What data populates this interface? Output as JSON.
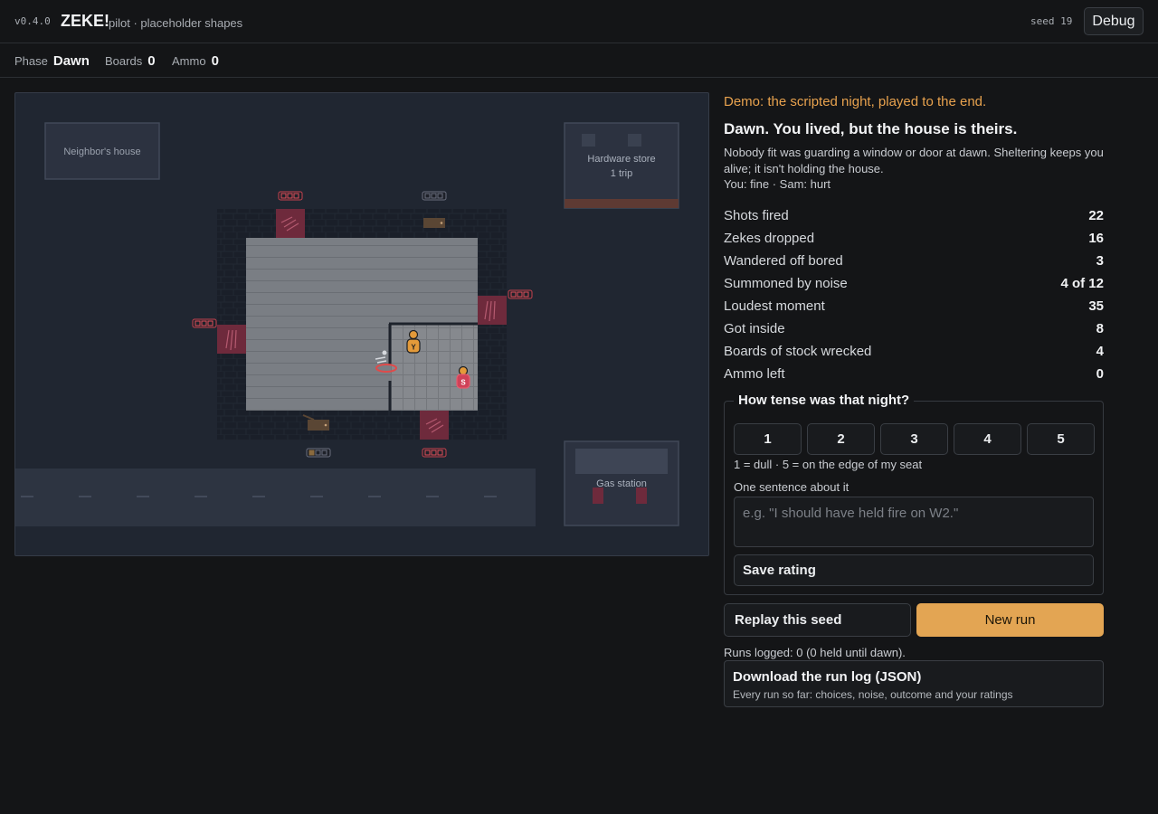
{
  "header": {
    "version": "v0.4.0",
    "brand": "ZEKE!",
    "tagline": "pilot · placeholder shapes",
    "seed": "seed 19",
    "debug_label": "Debug"
  },
  "status": {
    "phase_label": "Phase",
    "phase_value": "Dawn",
    "boards_label": "Boards",
    "boards_value": "0",
    "ammo_label": "Ammo",
    "ammo_value": "0"
  },
  "board": {
    "neighbor_label": "Neighbor's house",
    "hardware_label": "Hardware store",
    "hardware_trips": "1 trip",
    "gas_label": "Gas station",
    "you_token": "Y",
    "sam_token": "S",
    "colors": {
      "ground": "#202631",
      "lot": "#2d3441",
      "yard": "#1a1f29",
      "floor": "#787c82",
      "window_damaged": "#6e2a3c",
      "you": "#e39a3a",
      "sam": "#cf4158",
      "noise_ring": "#e04a4a"
    }
  },
  "result": {
    "demo_note": "Demo: the scripted night, played to the end.",
    "headline": "Dawn. You lived, but the house is theirs.",
    "body": "Nobody fit was guarding a window or door at dawn. Sheltering keeps you alive; it isn't holding the house.",
    "condition": "You: fine · Sam: hurt"
  },
  "stats": [
    {
      "label": "Shots fired",
      "value": "22"
    },
    {
      "label": "Zekes dropped",
      "value": "16"
    },
    {
      "label": "Wandered off bored",
      "value": "3"
    },
    {
      "label": "Summoned by noise",
      "value": "4 of 12"
    },
    {
      "label": "Loudest moment",
      "value": "35"
    },
    {
      "label": "Got inside",
      "value": "8"
    },
    {
      "label": "Boards of stock wrecked",
      "value": "4"
    },
    {
      "label": "Ammo left",
      "value": "0"
    }
  ],
  "rating": {
    "legend": "How tense was that night?",
    "options": [
      "1",
      "2",
      "3",
      "4",
      "5"
    ],
    "hint": "1 = dull · 5 = on the edge of my seat",
    "sentence_label": "One sentence about it",
    "sentence_value": "",
    "sentence_placeholder": "e.g. \"I should have held fire on W2.\"",
    "save_label": "Save rating"
  },
  "actions": {
    "replay_label": "Replay this seed",
    "new_run_label": "New run"
  },
  "log": {
    "runs_logged": "Runs logged: 0 (0 held until dawn).",
    "download_title": "Download the run log (JSON)",
    "download_sub": "Every run so far: choices, noise, outcome and your ratings"
  }
}
